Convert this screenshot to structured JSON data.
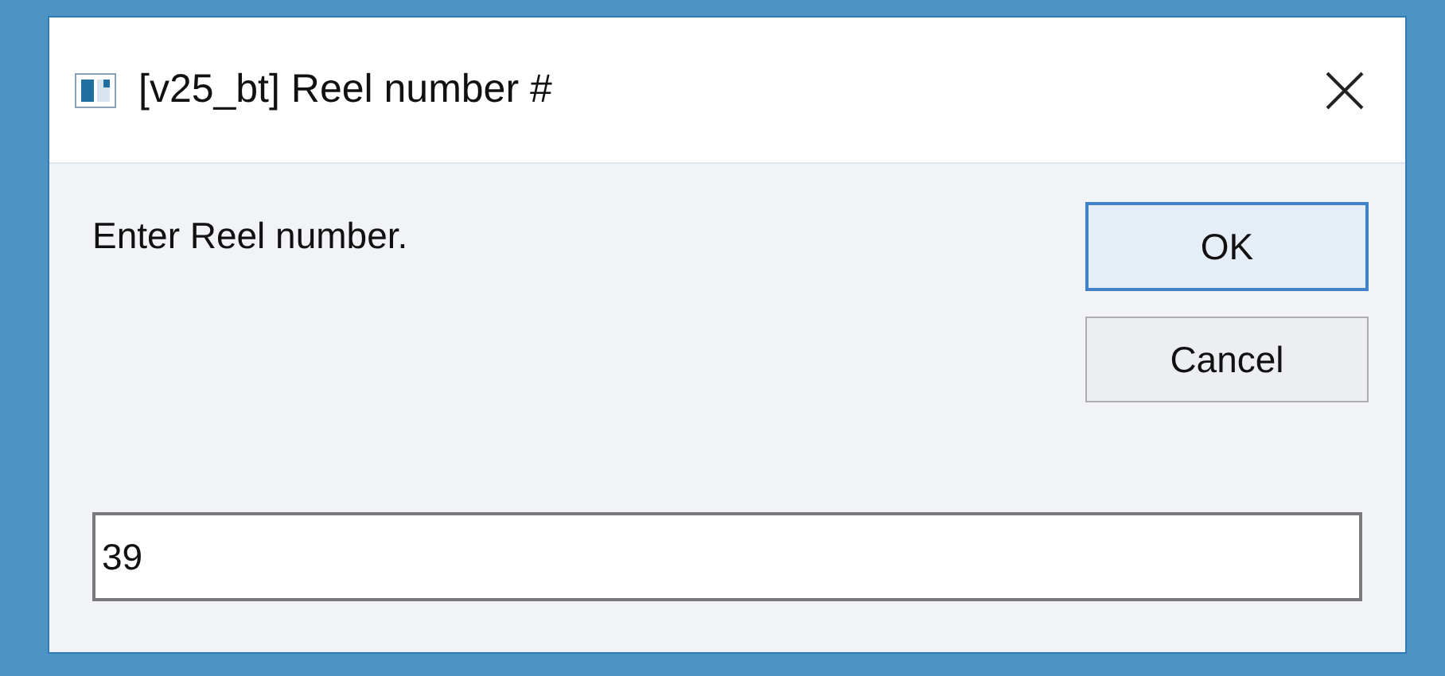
{
  "window": {
    "title": "[v25_bt] Reel number #"
  },
  "prompt": "Enter Reel number.",
  "buttons": [
    {
      "label": "OK",
      "default": true
    },
    {
      "label": "Cancel",
      "default": false
    }
  ],
  "input": {
    "value": "39"
  }
}
